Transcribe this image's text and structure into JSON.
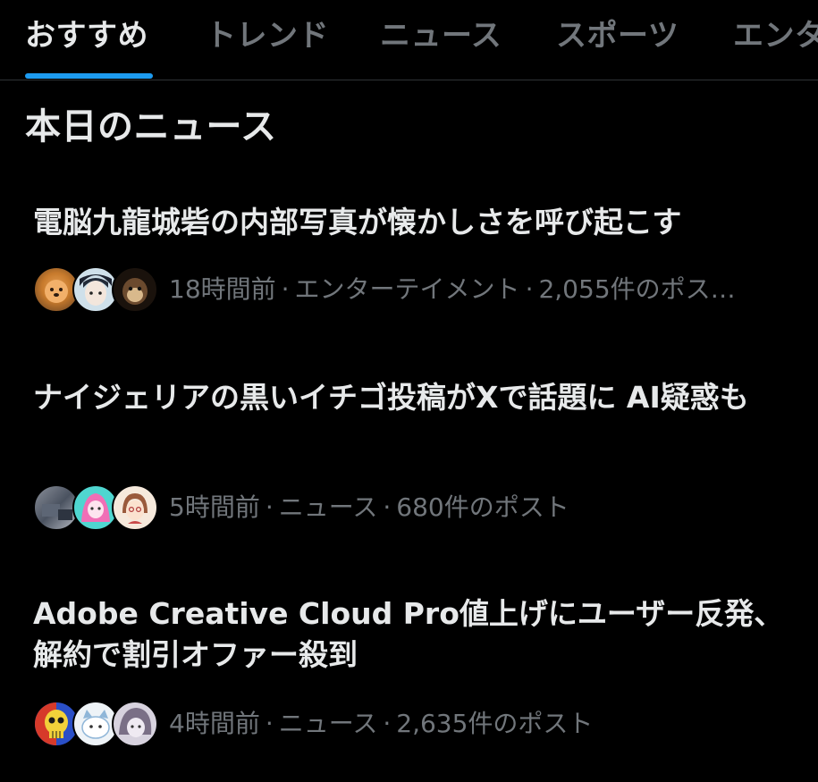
{
  "tabs": [
    {
      "label": "おすすめ",
      "active": true
    },
    {
      "label": "トレンド",
      "active": false
    },
    {
      "label": "ニュース",
      "active": false
    },
    {
      "label": "スポーツ",
      "active": false
    },
    {
      "label": "エンタ",
      "active": false
    }
  ],
  "section": {
    "title": "本日のニュース"
  },
  "news": [
    {
      "headline": "電脳九龍城砦の内部写真が懐かしさを呼び起こす",
      "time": "18時間前",
      "category": "エンターテイメント",
      "posts": "2,055件のポス…",
      "avatars": [
        "dog-avatar",
        "anime-boy-avatar",
        "monkey-avatar"
      ]
    },
    {
      "headline": "ナイジェリアの黒いイチゴ投稿がXで話題に AI疑惑も",
      "time": "5時間前",
      "category": "ニュース",
      "posts": "680件のポスト",
      "avatars": [
        "photo-avatar",
        "pink-character-avatar",
        "girl-illustration-avatar"
      ]
    },
    {
      "headline": "Adobe Creative Cloud Pro値上げにユーザー反発、解約で割引オファー殺到",
      "time": "4時間前",
      "category": "ニュース",
      "posts": "2,635件のポスト",
      "avatars": [
        "skull-avatar",
        "cat-character-avatar",
        "monochrome-character-avatar"
      ]
    }
  ],
  "colors": {
    "background": "#000000",
    "primary_text": "#e7e9ea",
    "secondary_text": "#71767b",
    "accent": "#1d9bf0",
    "divider": "#2f3336"
  }
}
